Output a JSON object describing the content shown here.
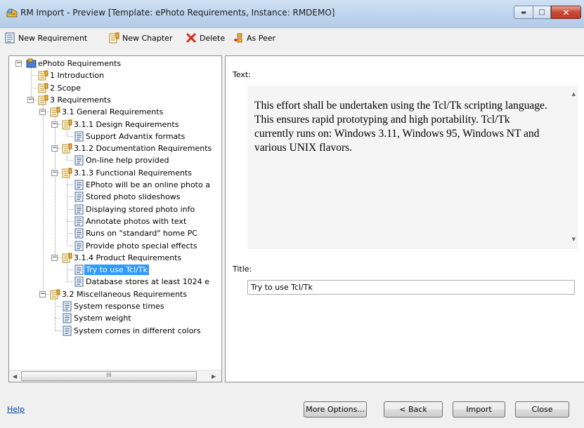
{
  "window": {
    "title": "RM Import - Preview [Template: ePhoto Requirements, Instance: RMDEMO]",
    "minimize_glyph": "▬",
    "maximize_glyph": "□",
    "close_glyph": "✕"
  },
  "toolbar": {
    "new_requirement": "New Requirement",
    "new_chapter": "New Chapter",
    "delete": "Delete",
    "as_peer": "As Peer"
  },
  "tree": {
    "nodes": [
      {
        "label": "ePhoto Requirements",
        "icon": "project-icon",
        "expander": "−"
      },
      {
        "label": "1 Introduction",
        "icon": "chapter-icon"
      },
      {
        "label": "2 Scope",
        "icon": "chapter-icon"
      },
      {
        "label": "3 Requirements",
        "icon": "chapter-icon",
        "expander": "−"
      },
      {
        "label": "3.1 General Requirements",
        "icon": "chapter-icon",
        "expander": "−"
      },
      {
        "label": "3.1.1 Design Requirements",
        "icon": "chapter-icon",
        "expander": "−"
      },
      {
        "label": "Support Advantix formats",
        "icon": "requirement-icon"
      },
      {
        "label": "3.1.2 Documentation Requirements",
        "icon": "chapter-icon",
        "expander": "−"
      },
      {
        "label": "On-line help provided",
        "icon": "requirement-icon"
      },
      {
        "label": "3.1.3 Functional Requirements",
        "icon": "chapter-icon",
        "expander": "−"
      },
      {
        "label": "EPhoto will be an online photo a",
        "icon": "requirement-icon"
      },
      {
        "label": "Stored photo slideshows",
        "icon": "requirement-icon"
      },
      {
        "label": "Displaying stored photo info",
        "icon": "requirement-icon"
      },
      {
        "label": "Annotate photos with text",
        "icon": "requirement-icon"
      },
      {
        "label": "Runs on \"standard\" home PC",
        "icon": "requirement-icon"
      },
      {
        "label": "Provide photo special effects",
        "icon": "requirement-icon"
      },
      {
        "label": "3.1.4 Product Requirements",
        "icon": "chapter-icon",
        "expander": "−"
      },
      {
        "label": "Try to use Tcl/Tk",
        "icon": "requirement-icon",
        "selected": true
      },
      {
        "label": "Database stores at least 1024 e",
        "icon": "requirement-icon"
      },
      {
        "label": "3.2 Miscellaneous Requirements",
        "icon": "chapter-icon",
        "expander": "−"
      },
      {
        "label": "System response times",
        "icon": "requirement-icon"
      },
      {
        "label": "System weight",
        "icon": "requirement-icon"
      },
      {
        "label": "System comes in different colors",
        "icon": "requirement-icon"
      }
    ],
    "scroll_thumb_grip": "III",
    "scroll_left": "◀",
    "scroll_right": "▶"
  },
  "detail": {
    "text_label": "Text:",
    "text_content": "This effort shall be undertaken using the Tcl/Tk scripting language. This ensures rapid prototyping and high portability. Tcl/Tk currently runs on: Windows 3.11, Windows 95, Windows NT and various UNIX flavors.",
    "title_label": "Title:",
    "title_value": "Try to use Tcl/Tk",
    "scroll_up": "▲",
    "scroll_down": "▼"
  },
  "footer": {
    "help": "Help",
    "more_options": "More Options...",
    "back": "< Back",
    "import": "Import",
    "close": "Close"
  },
  "colors": {
    "selection": "#3399ff",
    "link": "#0645ad"
  }
}
